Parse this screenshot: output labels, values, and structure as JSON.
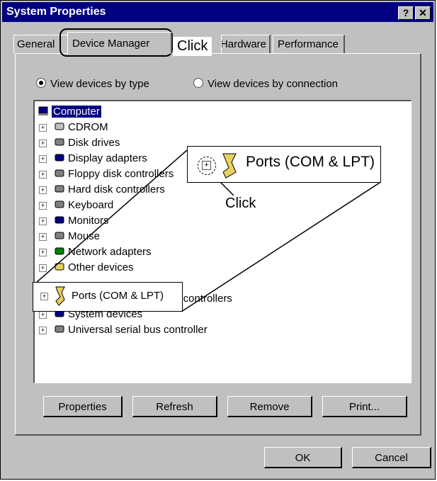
{
  "window": {
    "title": "System Properties",
    "help_btn": "?",
    "close_btn": "✕"
  },
  "tabs": [
    "General",
    "Device Manager",
    "Hardware Profiles",
    "Performance"
  ],
  "radios": [
    {
      "label": "View devices by type",
      "checked": true
    },
    {
      "label": "View devices by connection",
      "checked": false
    }
  ],
  "tree": {
    "root": "Computer",
    "items": [
      "CDROM",
      "Disk drives",
      "Display adapters",
      "Floppy disk controllers",
      "Hard disk controllers",
      "Keyboard",
      "Monitors",
      "Mouse",
      "Network adapters",
      "Other devices",
      "Ports (COM & LPT)",
      "Sound, video and game controllers",
      "System devices",
      "Universal serial bus controller"
    ]
  },
  "buttons": {
    "properties": "Properties",
    "refresh": "Refresh",
    "remove": "Remove",
    "print": "Print...",
    "ok": "OK",
    "cancel": "Cancel"
  },
  "annotations": {
    "click_tab": "Click",
    "click_plus": "Click",
    "zoom_label": "Ports (COM & LPT)"
  }
}
